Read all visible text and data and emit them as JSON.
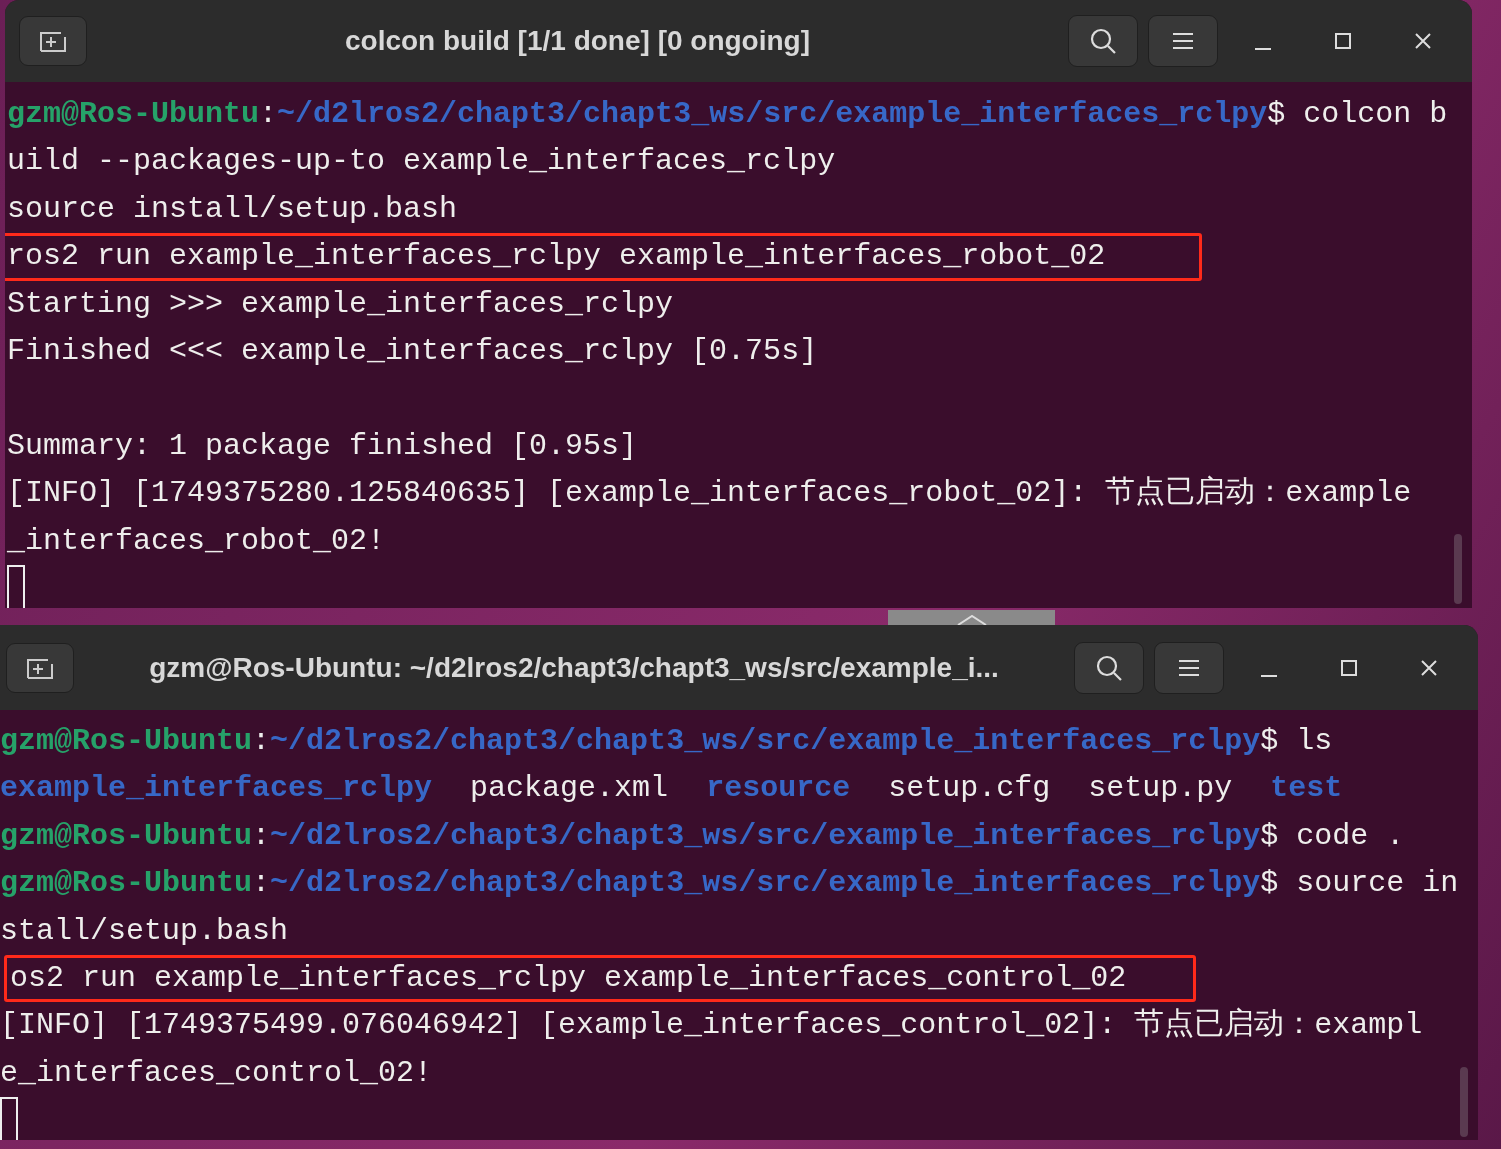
{
  "windows": [
    {
      "title": "colcon build [1/1 done] [0 ongoing]",
      "lines": [
        {
          "highlighted": false,
          "segments": [
            {
              "kind": "user",
              "text": "gzm@Ros-Ubuntu"
            },
            {
              "kind": "plain",
              "text": ":"
            },
            {
              "kind": "path",
              "text": "~/d2lros2/chapt3/chapt3_ws/src/example_interfaces_rclpy"
            },
            {
              "kind": "plain",
              "text": "$ colcon b"
            }
          ]
        },
        {
          "highlighted": false,
          "segments": [
            {
              "kind": "plain",
              "text": "uild --packages-up-to example_interfaces_rclpy"
            }
          ]
        },
        {
          "highlighted": false,
          "segments": [
            {
              "kind": "plain",
              "text": "source install/setup.bash"
            }
          ]
        },
        {
          "highlighted": true,
          "segments": [
            {
              "kind": "plain",
              "text": "ros2 run example_interfaces_rclpy example_interfaces_robot_02"
            }
          ]
        },
        {
          "highlighted": false,
          "segments": [
            {
              "kind": "plain",
              "text": "Starting >>> example_interfaces_rclpy"
            }
          ]
        },
        {
          "highlighted": false,
          "segments": [
            {
              "kind": "plain",
              "text": "Finished <<< example_interfaces_rclpy [0.75s]"
            }
          ]
        },
        {
          "highlighted": false
        },
        {
          "highlighted": false,
          "segments": [
            {
              "kind": "plain",
              "text": "Summary: 1 package finished [0.95s]"
            }
          ]
        },
        {
          "highlighted": false,
          "segments": [
            {
              "kind": "plain",
              "text": "[INFO] [1749375280.125840635] [example_interfaces_robot_02]: 节点已启动：example"
            }
          ]
        },
        {
          "highlighted": false,
          "segments": [
            {
              "kind": "plain",
              "text": "_interfaces_robot_02!"
            }
          ]
        }
      ]
    },
    {
      "title": "gzm@Ros-Ubuntu: ~/d2lros2/chapt3/chapt3_ws/src/example_i...",
      "lines": [
        {
          "highlighted": false,
          "segments": [
            {
              "kind": "user",
              "text": "gzm@Ros-Ubuntu"
            },
            {
              "kind": "plain",
              "text": ":"
            },
            {
              "kind": "path",
              "text": "~/d2lros2/chapt3/chapt3_ws/src/example_interfaces_rclpy"
            },
            {
              "kind": "plain",
              "text": "$ ls"
            }
          ]
        },
        {
          "highlighted": false,
          "segments": [
            {
              "kind": "dir",
              "text": "example_interfaces_rclpy"
            },
            {
              "kind": "file",
              "text": "package.xml"
            },
            {
              "kind": "dir",
              "text": "resource"
            },
            {
              "kind": "file",
              "text": "setup.cfg"
            },
            {
              "kind": "file",
              "text": "setup.py"
            },
            {
              "kind": "dir",
              "text": "test"
            }
          ]
        },
        {
          "highlighted": false,
          "segments": [
            {
              "kind": "user",
              "text": "gzm@Ros-Ubuntu"
            },
            {
              "kind": "plain",
              "text": ":"
            },
            {
              "kind": "path",
              "text": "~/d2lros2/chapt3/chapt3_ws/src/example_interfaces_rclpy"
            },
            {
              "kind": "plain",
              "text": "$ code ."
            }
          ]
        },
        {
          "highlighted": false,
          "segments": [
            {
              "kind": "user",
              "text": "gzm@Ros-Ubuntu"
            },
            {
              "kind": "plain",
              "text": ":"
            },
            {
              "kind": "path",
              "text": "~/d2lros2/chapt3/chapt3_ws/src/example_interfaces_rclpy"
            },
            {
              "kind": "plain",
              "text": "$ source in"
            }
          ]
        },
        {
          "highlighted": false,
          "segments": [
            {
              "kind": "plain",
              "text": "stall/setup.bash"
            }
          ]
        },
        {
          "highlighted": true,
          "segments": [
            {
              "kind": "plain",
              "text": "os2 run example_interfaces_rclpy example_interfaces_control_02"
            }
          ]
        },
        {
          "highlighted": false,
          "segments": [
            {
              "kind": "plain",
              "text": "[INFO] [1749375499.076046942] [example_interfaces_control_02]: 节点已启动：exampl"
            }
          ]
        },
        {
          "highlighted": false,
          "segments": [
            {
              "kind": "plain",
              "text": "e_interfaces_control_02!"
            }
          ]
        }
      ]
    }
  ]
}
